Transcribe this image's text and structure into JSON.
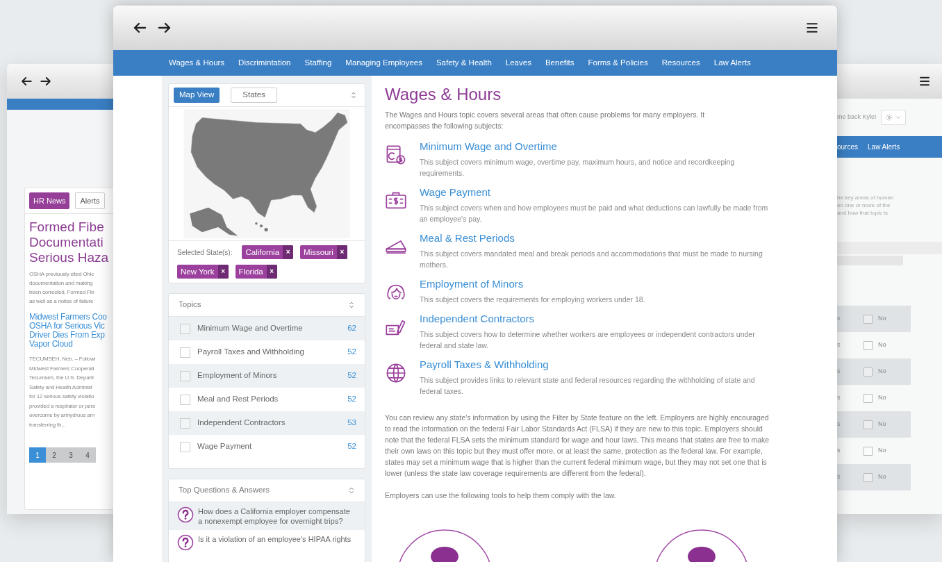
{
  "left_window": {
    "tabs": [
      {
        "label": "HR News",
        "selected": true
      },
      {
        "label": "Alerts",
        "selected": false
      }
    ],
    "headline": [
      "Formed Fibe",
      "Documentati",
      "Serious Haza"
    ],
    "summary": [
      "OSHA previously cited Ohic",
      "documentation and making",
      "been corrected, Formed Fib",
      "as well as a notice of failure"
    ],
    "link_title": [
      "Midwest Farmers Coo",
      "OSHA for Serious Vic",
      "Driver Dies From Exp",
      "Vapor Cloud"
    ],
    "body": [
      "TECUMSEH, Neb. – Followi",
      "Midwest Farmers Cooperati",
      "Tecumseh, the U.S. Departr",
      "Safety and Health Administ",
      "for 12 serious safety violatio",
      "provided a respirator or pers",
      "overcome by anhydrous am",
      "transferring th..."
    ],
    "pages": [
      {
        "label": "1",
        "selected": true
      },
      {
        "label": "2",
        "selected": false
      },
      {
        "label": "3",
        "selected": false
      },
      {
        "label": "4",
        "selected": false
      }
    ]
  },
  "main_window": {
    "nav": [
      "Wages & Hours",
      "Discrimintation",
      "Staffing",
      "Managing Employees",
      "Safety & Health",
      "Leaves",
      "Benefits",
      "Forms & Policies",
      "Resources",
      "Law Alerts"
    ],
    "map_card": {
      "tabs": [
        {
          "label": "Map View",
          "selected": true
        },
        {
          "label": "States",
          "selected": false
        }
      ],
      "selected_label": "Selected State(s):",
      "states": [
        "California",
        "Missouri",
        "New York",
        "Florida"
      ],
      "remove_glyph": "×"
    },
    "topics_card": {
      "title": "Topics",
      "items": [
        {
          "label": "Minimum Wage and Overtime",
          "count": "62",
          "checked": false
        },
        {
          "label": "Payroll Taxes and Withholding",
          "count": "52",
          "checked": false
        },
        {
          "label": "Employment of Minors",
          "count": "52",
          "checked": false
        },
        {
          "label": "Meal and Rest Periods",
          "count": "52",
          "checked": false
        },
        {
          "label": "Independent Contractors",
          "count": "53",
          "checked": false
        },
        {
          "label": "Wage Payment",
          "count": "52",
          "checked": false
        }
      ]
    },
    "questions_card": {
      "title": "Top Questions & Answers",
      "items": [
        "How does a California employer compensate a nonexempt employee for overnight trips?",
        "Is it a violation of an employee's HIPAA rights"
      ]
    },
    "content": {
      "title": "Wages & Hours",
      "intro": "The Wages and Hours topic covers several areas that often cause problems for many employers. It encompasses the following subjects:",
      "subjects": [
        {
          "title": "Minimum Wage and Overtime",
          "text": "This subject covers minimum wage, overtime pay, maximum hours, and notice and recordkeeping requirements."
        },
        {
          "title": "Wage Payment",
          "text": "This subject covers when and how employees must be paid and what deductions can lawfully be made from an employee's pay."
        },
        {
          "title": "Meal & Rest Periods",
          "text": "This subject covers mandated meal and break periods and accommodations that must be made to nursing mothers."
        },
        {
          "title": "Employment of Minors",
          "text": "This subject covers the requirements for employing workers under 18."
        },
        {
          "title": "Independent Contractors",
          "text": "This subject covers how to determine whether workers are employees or independent contractors under federal and state law."
        },
        {
          "title": "Payroll Taxes & Withholding",
          "text": "This subject provides links to relevant state and federal resources regarding the withholding of state and federal taxes."
        }
      ],
      "paragraphs": [
        "You can review any state's information by using the Filter by State feature on the left. Employers are highly encouraged to read the information on the federal Fair Labor Standards Act (FLSA) if they are new to this topic. Employers should note that the federal FLSA sets the minimum standard for wage and hour laws. This means that states are free to make their own laws on this topic but they must offer more, or at least the same, protection as the federal law. For example, states may set a minimum wage that is higher than the current federal minimum wage, but they may not set one that is lower (unless the state law coverage requirements are different from the federal).",
        "Employers can use the following tools to help them comply with the law."
      ]
    }
  },
  "right_window": {
    "welcome": "me back Kyle!",
    "nav": [
      "ources",
      "Law Alerts"
    ],
    "text_lines": [
      "he key areas of human",
      "on one or more of the",
      "and how that topic is"
    ],
    "rows": [
      {
        "cell": "s",
        "label": "No",
        "checked": false
      },
      {
        "cell": "s",
        "label": "No",
        "checked": false
      },
      {
        "cell": "s",
        "label": "No",
        "checked": false
      },
      {
        "cell": "s",
        "label": "No",
        "checked": false
      },
      {
        "cell": "s",
        "label": "No",
        "checked": false
      },
      {
        "cell": "s",
        "label": "No",
        "checked": false
      },
      {
        "cell": "s",
        "label": "No",
        "checked": false
      }
    ]
  }
}
